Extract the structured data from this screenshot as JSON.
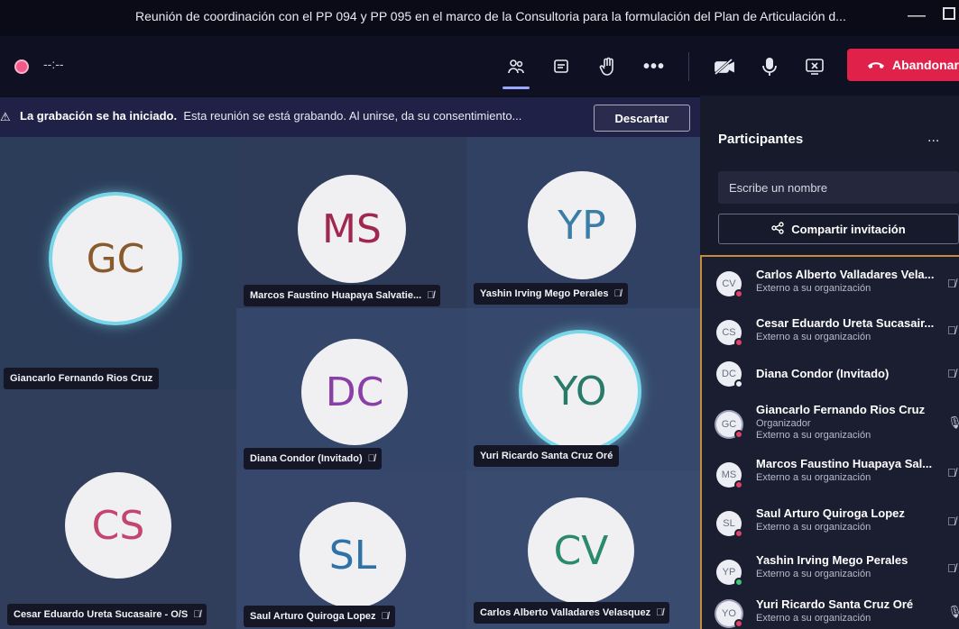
{
  "window": {
    "title": "Reunión de coordinación con el PP 094 y PP 095 en el marco de la Consultoria para la formulación del Plan de Articulación d...",
    "minimize": "—"
  },
  "toolbar": {
    "timer": "--:--",
    "leave_label": "Abandonar",
    "icons": [
      "people-icon",
      "chat-icon",
      "raise-hand-icon",
      "more-icon",
      "camera-off-icon",
      "mic-icon",
      "share-screen-icon"
    ]
  },
  "banner": {
    "warning": "⚠",
    "bold": "La grabación se ha iniciado.",
    "text": "Esta reunión se está grabando. Al unirse, da su consentimiento...",
    "discard_label": "Descartar"
  },
  "tiles": [
    {
      "initials": "GC",
      "name": "Giancarlo Fernando Rios Cruz",
      "color": "#8a5a2c",
      "muted": false,
      "speaking": true
    },
    {
      "initials": "MS",
      "name": "Marcos Faustino Huapaya Salvatie...",
      "color": "#a0284f",
      "muted": true,
      "speaking": false
    },
    {
      "initials": "YP",
      "name": "Yashin Irving Mego Perales",
      "color": "#3a7ea8",
      "muted": true,
      "speaking": false
    },
    {
      "initials": "DC",
      "name": "Diana Condor (Invitado)",
      "color": "#8a3fa6",
      "muted": true,
      "speaking": false
    },
    {
      "initials": "YO",
      "name": "Yuri Ricardo Santa Cruz Oré",
      "color": "#2a7a6a",
      "muted": false,
      "speaking": true
    },
    {
      "initials": "CS",
      "name": "Cesar Eduardo Ureta Sucasaire - O/S",
      "color": "#c4456e",
      "muted": true,
      "speaking": false
    },
    {
      "initials": "SL",
      "name": "Saul Arturo Quiroga Lopez",
      "color": "#2e72a8",
      "muted": true,
      "speaking": false
    },
    {
      "initials": "CV",
      "name": "Carlos Alberto Valladares Velasquez",
      "color": "#2a8a6a",
      "muted": true,
      "speaking": false
    }
  ],
  "panel": {
    "title": "Participantes",
    "more": "...",
    "search_placeholder": "Escribe un nombre",
    "share_label": "Compartir invitación",
    "participants": [
      {
        "initials": "CV",
        "name": "Carlos Alberto Valladares Vela...",
        "sub": "Externo a su organización",
        "sub2": "",
        "online": false,
        "mic": "off"
      },
      {
        "initials": "CS",
        "name": "Cesar Eduardo Ureta Sucasair...",
        "sub": "Externo a su organización",
        "sub2": "",
        "online": false,
        "mic": "off"
      },
      {
        "initials": "DC",
        "name": "Diana Condor (Invitado)",
        "sub": "",
        "sub2": "",
        "online": false,
        "mic": "off"
      },
      {
        "initials": "GC",
        "name": "Giancarlo Fernando Rios Cruz",
        "sub": "Organizador",
        "sub2": "Externo a su organización",
        "online": false,
        "mic": "on"
      },
      {
        "initials": "MS",
        "name": "Marcos Faustino Huapaya Sal...",
        "sub": "Externo a su organización",
        "sub2": "",
        "online": false,
        "mic": "off"
      },
      {
        "initials": "SL",
        "name": "Saul Arturo Quiroga Lopez",
        "sub": "Externo a su organización",
        "sub2": "",
        "online": false,
        "mic": "off"
      },
      {
        "initials": "YP",
        "name": "Yashin Irving Mego Perales",
        "sub": "Externo a su organización",
        "sub2": "",
        "online": true,
        "mic": "off"
      },
      {
        "initials": "YO",
        "name": "Yuri Ricardo Santa Cruz Oré",
        "sub": "Externo a su organización",
        "sub2": "",
        "online": false,
        "mic": "on"
      }
    ]
  }
}
